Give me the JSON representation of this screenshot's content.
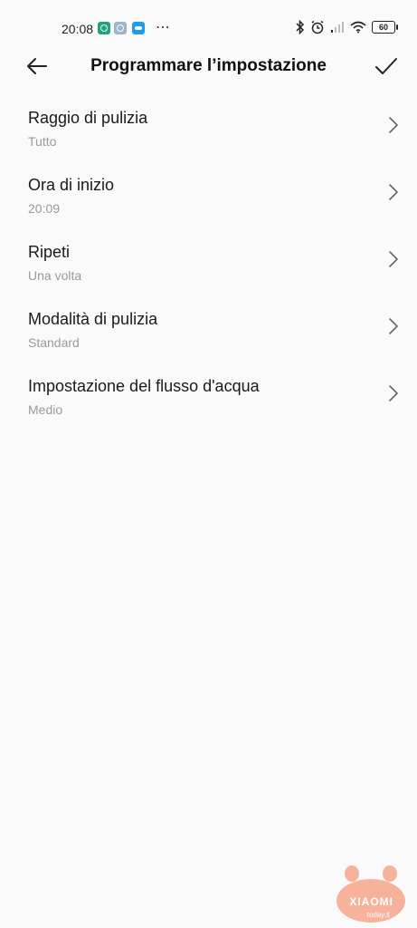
{
  "status_bar": {
    "time": "20:08",
    "apps": [
      "app-green-icon",
      "app-gray-icon",
      "twitter-icon"
    ],
    "more": "⋯",
    "battery": "60"
  },
  "header": {
    "title": "Programmare l’impostazione"
  },
  "settings": [
    {
      "label": "Raggio di pulizia",
      "value": "Tutto"
    },
    {
      "label": "Ora di inizio",
      "value": "20:09"
    },
    {
      "label": "Ripeti",
      "value": "Una volta"
    },
    {
      "label": "Modalità di pulizia",
      "value": "Standard"
    },
    {
      "label": "Impostazione del flusso d'acqua",
      "value": "Medio"
    }
  ],
  "watermark": {
    "brand": "XIAOMI",
    "site": "today.it"
  },
  "colors": {
    "background": "#fafafa",
    "secondary_text": "#9a9a9a",
    "watermark": "#f4a58a"
  }
}
